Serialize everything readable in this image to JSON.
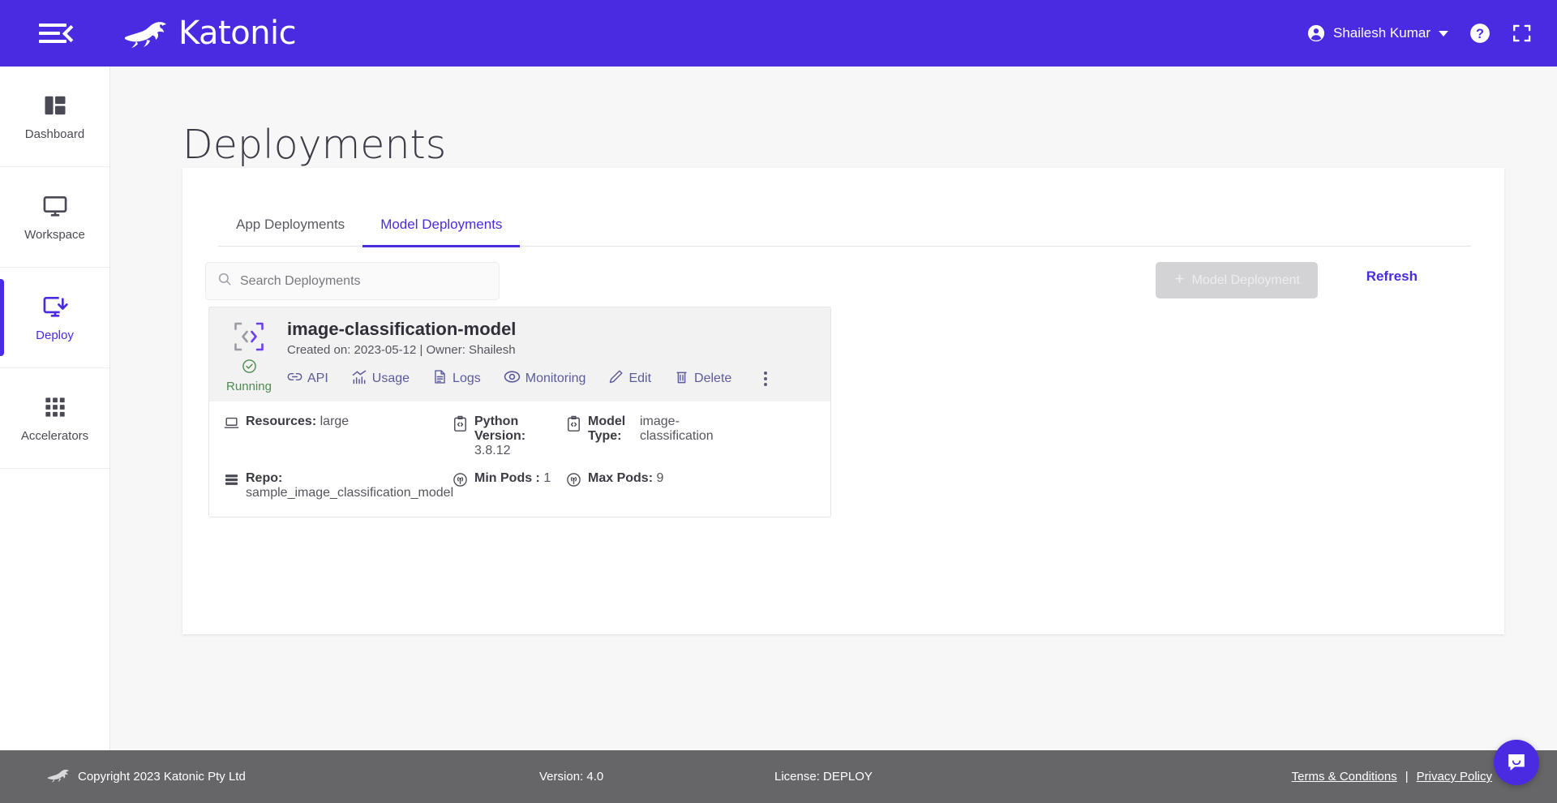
{
  "header": {
    "brand": "Katonic",
    "menu_icon": "hamburger-collapse-icon",
    "user": "Shailesh Kumar",
    "help_icon": "help-icon",
    "fullscreen_icon": "fullscreen-icon",
    "bg_color": "#4a2be2"
  },
  "sidebar": {
    "items": [
      {
        "label": "Dashboard",
        "icon": "dashboard-icon",
        "active": false
      },
      {
        "label": "Workspace",
        "icon": "monitor-icon",
        "active": false
      },
      {
        "label": "Deploy",
        "icon": "deploy-download-icon",
        "active": true
      },
      {
        "label": "Accelerators",
        "icon": "grid-apps-icon",
        "active": false
      }
    ],
    "active_color": "#4a2be2"
  },
  "page": {
    "title": "Deployments"
  },
  "tabs": [
    {
      "label": "App Deployments",
      "active": false
    },
    {
      "label": "Model Deployments",
      "active": true
    }
  ],
  "search": {
    "placeholder": "Search Deployments",
    "value": "",
    "icon": "search-icon"
  },
  "toolbar": {
    "new_deployment_label": "Model Deployment",
    "new_deployment_icon": "plus-icon",
    "new_deployment_disabled": true,
    "refresh_label": "Refresh",
    "refresh_color": "#4a2be2"
  },
  "deployment": {
    "icon": "code-brackets-icon",
    "status": "Running",
    "status_icon": "check-circle-icon",
    "status_color": "#4f8a52",
    "name": "image-classification-model",
    "subtitle": "Created on: 2023-05-12 | Owner: Shailesh",
    "actions": [
      {
        "label": "API",
        "icon": "link-icon"
      },
      {
        "label": "Usage",
        "icon": "chart-usage-icon"
      },
      {
        "label": "Logs",
        "icon": "document-logs-icon"
      },
      {
        "label": "Monitoring",
        "icon": "eye-monitoring-icon"
      },
      {
        "label": "Edit",
        "icon": "pencil-edit-icon"
      },
      {
        "label": "Delete",
        "icon": "trash-delete-icon"
      }
    ],
    "more_icon": "kebab-menu-icon",
    "details": [
      {
        "key": "Resources:",
        "value": "large",
        "icon": "laptop-icon"
      },
      {
        "key": "Python Version:",
        "value": "3.8.12",
        "icon": "code-clipboard-icon"
      },
      {
        "key": "Model Type:",
        "value": "image-classification",
        "icon": "code-clipboard-icon"
      },
      {
        "key": "Repo:",
        "value": "sample_image_classification_model",
        "icon": "server-repo-icon"
      },
      {
        "key": "Min Pods :",
        "value": "1",
        "icon": "pods-signal-icon"
      },
      {
        "key": "Max Pods:",
        "value": "9",
        "icon": "pods-signal-icon"
      }
    ]
  },
  "footer": {
    "copyright": "Copyright 2023 Katonic Pty Ltd",
    "version": "Version: 4.0",
    "license": "License: DEPLOY",
    "terms": "Terms & Conditions",
    "separator": "|",
    "privacy": "Privacy Policy",
    "logo_icon": "kangaroo-logo-icon"
  },
  "chat": {
    "icon": "chat-bubble-icon",
    "color": "#4a2be2"
  }
}
